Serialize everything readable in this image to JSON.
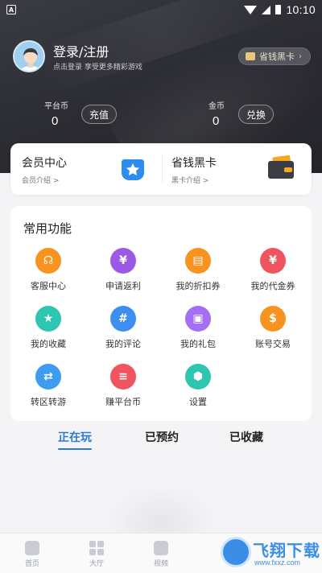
{
  "status_bar": {
    "left_badge": "A",
    "time": "10:10"
  },
  "profile": {
    "title": "登录/注册",
    "subtitle": "点击登录 享受更多精彩游戏",
    "vip_pill_label": "省钱黑卡"
  },
  "wallet": {
    "platform_coin_label": "平台币",
    "platform_coin_value": "0",
    "recharge_label": "充值",
    "gold_label": "金币",
    "gold_value": "0",
    "exchange_label": "兑换"
  },
  "member_card": {
    "member_center_title": "会员中心",
    "member_center_sub": "会员介绍 >",
    "black_card_title": "省钱黑卡",
    "black_card_sub": "黑卡介绍 >"
  },
  "functions": {
    "title": "常用功能",
    "items": [
      {
        "label": "客服中心",
        "icon": "headset-icon",
        "color": "#f7931e"
      },
      {
        "label": "申请返利",
        "icon": "rebate-icon",
        "color": "#9b59e6"
      },
      {
        "label": "我的折扣券",
        "icon": "coupon-icon",
        "color": "#f7931e"
      },
      {
        "label": "我的代金券",
        "icon": "voucher-icon",
        "color": "#f0545e"
      },
      {
        "label": "我的收藏",
        "icon": "star-icon",
        "color": "#2fc6b1"
      },
      {
        "label": "我的评论",
        "icon": "comment-icon",
        "color": "#3d8ef0"
      },
      {
        "label": "我的礼包",
        "icon": "gift-icon",
        "color": "#a46ef5"
      },
      {
        "label": "账号交易",
        "icon": "money-bag-icon",
        "color": "#f7931e"
      },
      {
        "label": "转区转游",
        "icon": "transfer-icon",
        "color": "#3d9bf0"
      },
      {
        "label": "赚平台币",
        "icon": "coin-stack-icon",
        "color": "#f0545e"
      },
      {
        "label": "设置",
        "icon": "settings-icon",
        "color": "#2fc6b1"
      }
    ]
  },
  "tabs": [
    {
      "label": "正在玩",
      "active": true
    },
    {
      "label": "已预约",
      "active": false
    },
    {
      "label": "已收藏",
      "active": false
    }
  ],
  "bottom_nav": [
    {
      "label": "首页",
      "icon": "home-icon"
    },
    {
      "label": "大厅",
      "icon": "grid-icon"
    },
    {
      "label": "视频",
      "icon": "video-icon"
    }
  ],
  "watermark": {
    "text": "飞翔下载",
    "url": "www.fxxz.com"
  }
}
